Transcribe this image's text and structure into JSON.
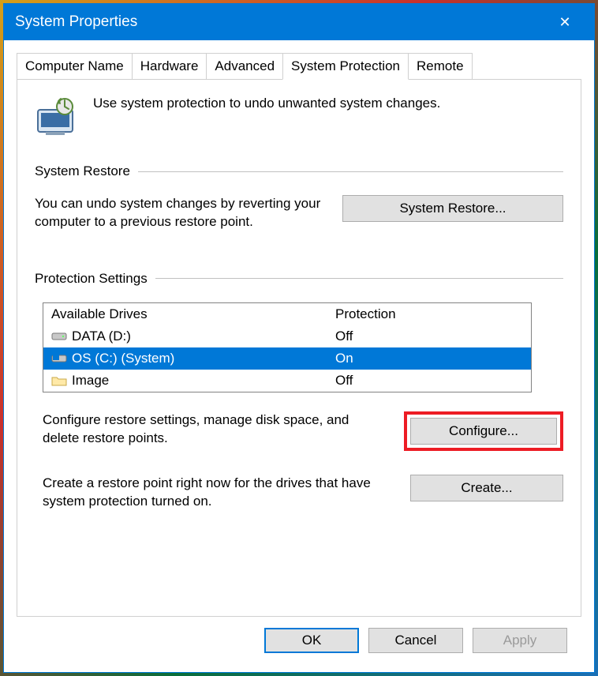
{
  "window": {
    "title": "System Properties",
    "close_glyph": "✕"
  },
  "tabs": [
    {
      "label": "Computer Name"
    },
    {
      "label": "Hardware"
    },
    {
      "label": "Advanced"
    },
    {
      "label": "System Protection",
      "active": true
    },
    {
      "label": "Remote"
    }
  ],
  "intro": "Use system protection to undo unwanted system changes.",
  "section_restore": {
    "title": "System Restore",
    "desc": "You can undo system changes by reverting your computer to a previous restore point.",
    "button": "System Restore..."
  },
  "section_protection": {
    "title": "Protection Settings",
    "headers": {
      "c1": "Available Drives",
      "c2": "Protection"
    },
    "drives": [
      {
        "icon": "hdd-icon",
        "name": "DATA (D:)",
        "protection": "Off",
        "selected": false
      },
      {
        "icon": "windrive-icon",
        "name": "OS (C:) (System)",
        "protection": "On",
        "selected": true
      },
      {
        "icon": "folder-icon",
        "name": "Image",
        "protection": "Off",
        "selected": false
      }
    ],
    "configure_desc": "Configure restore settings, manage disk space, and delete restore points.",
    "configure_button": "Configure...",
    "create_desc": "Create a restore point right now for the drives that have system protection turned on.",
    "create_button": "Create..."
  },
  "footer": {
    "ok": "OK",
    "cancel": "Cancel",
    "apply": "Apply"
  }
}
